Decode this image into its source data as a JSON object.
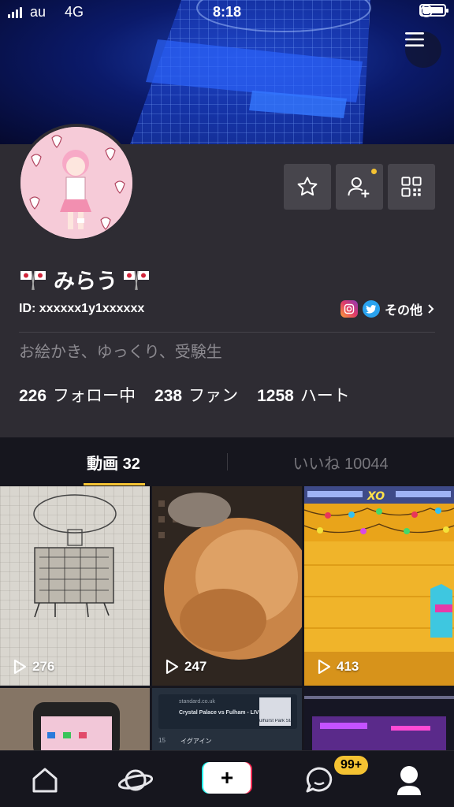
{
  "status_bar": {
    "carrier": "au",
    "network": "4G",
    "time": "8:18"
  },
  "profile": {
    "display_name": "みらう",
    "user_id": "ID: xxxxxx1y1xxxxxx",
    "social_more": "その他",
    "bio": "お絵かき、ゆっくり、受験生",
    "stats": [
      {
        "value": "226",
        "label": "フォロー中"
      },
      {
        "value": "238",
        "label": "ファン"
      },
      {
        "value": "1258",
        "label": "ハート"
      }
    ]
  },
  "tabs": {
    "videos": "動画 32",
    "likes": "いいね 10044"
  },
  "videos": [
    {
      "plays": "276"
    },
    {
      "plays": "247"
    },
    {
      "plays": "413"
    }
  ],
  "second_row": {
    "site": "standard.co.uk",
    "headline": "Crystal Palace vs Fulham - LIVE!",
    "thumb_caption": "ulhurst Park Stadi",
    "comment_num": "15",
    "comment_user": "イグアイン"
  },
  "game_label": "XO",
  "bottom_nav": {
    "badge": "99+",
    "plus": "+"
  },
  "colors": {
    "accent": "#f4c232",
    "background": "#16161e",
    "profile_bg": "#2e2c33"
  }
}
